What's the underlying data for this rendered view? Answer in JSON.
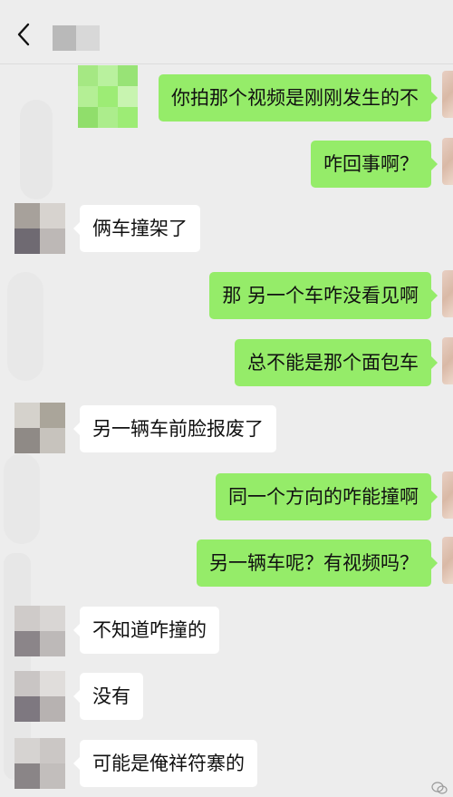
{
  "header": {
    "back_icon": "chevron-left-icon",
    "contact_name_obscured": true
  },
  "colors": {
    "background": "#ededed",
    "outgoing_bubble": "#95ec69",
    "incoming_bubble": "#ffffff",
    "text": "#111111"
  },
  "messages": [
    {
      "side": "right",
      "text": "你拍那个视频是刚刚发生的不"
    },
    {
      "side": "right",
      "text": "咋回事啊？"
    },
    {
      "side": "left",
      "text": "俩车撞架了"
    },
    {
      "side": "right",
      "text": "那 另一个车咋没看见啊"
    },
    {
      "side": "right",
      "text": "总不能是那个面包车"
    },
    {
      "side": "left",
      "text": "另一辆车前脸报废了"
    },
    {
      "side": "right",
      "text": "同一个方向的咋能撞啊"
    },
    {
      "side": "right",
      "text": "另一辆车呢？有视频吗？"
    },
    {
      "side": "left",
      "text": "不知道咋撞的"
    },
    {
      "side": "left",
      "text": "没有"
    },
    {
      "side": "left",
      "text": "可能是俺祥符寨的"
    }
  ]
}
